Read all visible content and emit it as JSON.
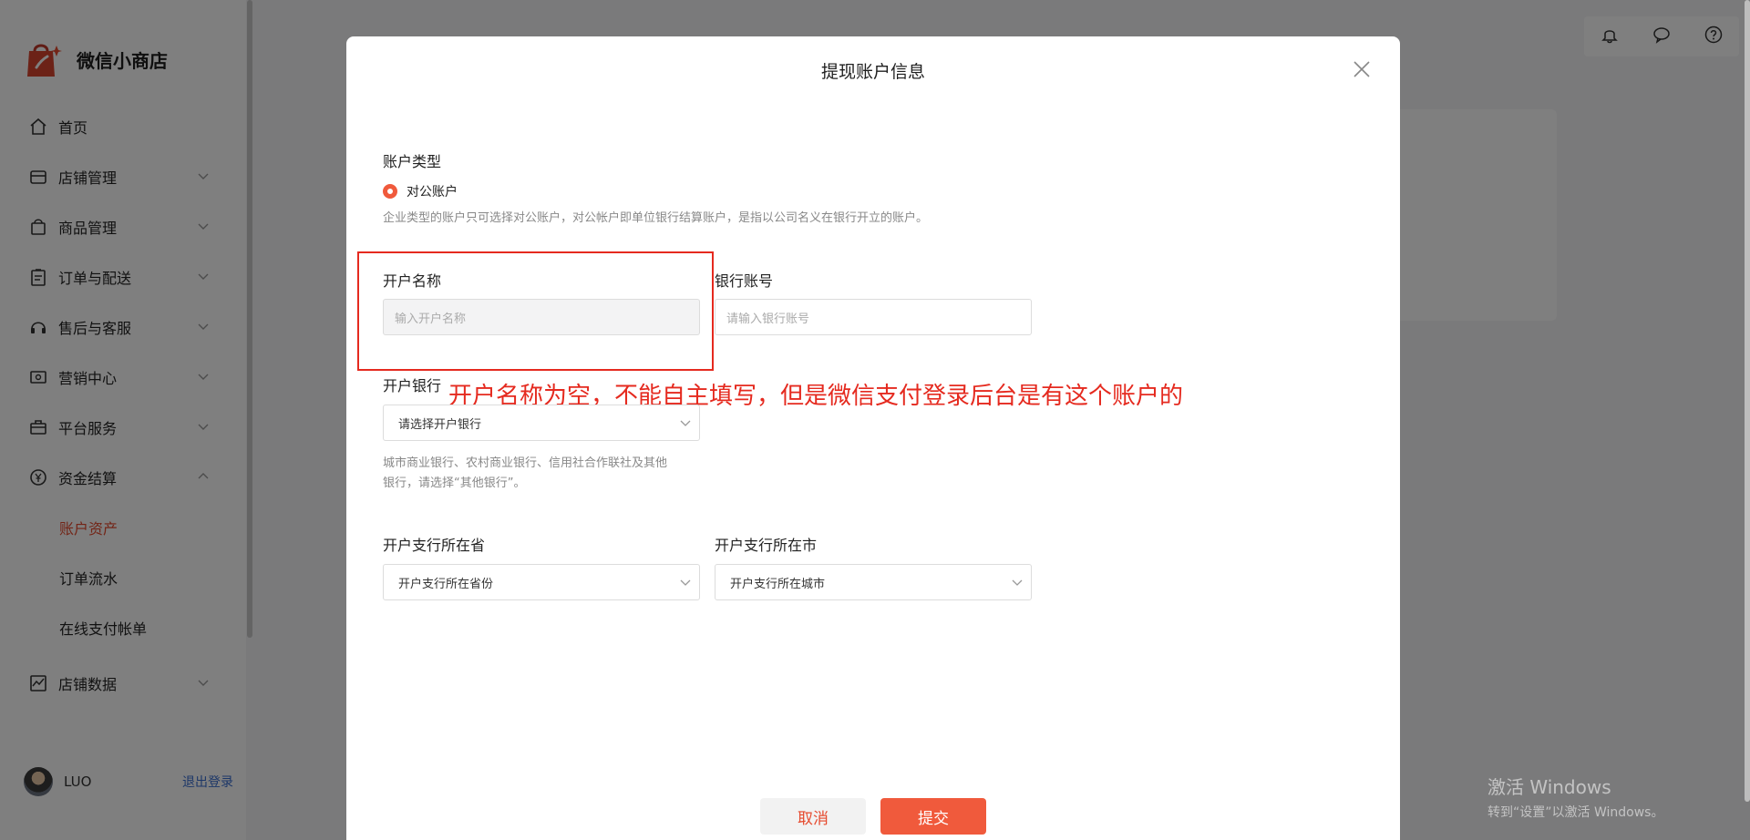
{
  "app": {
    "name": "微信小商店"
  },
  "sidebar": {
    "items": [
      {
        "label": "首页",
        "icon": "home-icon"
      },
      {
        "label": "店铺管理",
        "icon": "store-icon"
      },
      {
        "label": "商品管理",
        "icon": "bag-icon"
      },
      {
        "label": "订单与配送",
        "icon": "clipboard-icon"
      },
      {
        "label": "售后与客服",
        "icon": "headset-icon"
      },
      {
        "label": "营销中心",
        "icon": "ticket-icon"
      },
      {
        "label": "平台服务",
        "icon": "briefcase-icon"
      },
      {
        "label": "资金结算",
        "icon": "yen-icon"
      }
    ],
    "subitems": [
      {
        "label": "账户资产",
        "active": true
      },
      {
        "label": "订单流水",
        "active": false
      },
      {
        "label": "在线支付帐单",
        "active": false
      }
    ],
    "last_item": {
      "label": "店铺数据",
      "icon": "chart-icon"
    },
    "user": {
      "name": "LUO",
      "logout": "退出登录"
    }
  },
  "modal": {
    "title": "提现账户信息",
    "account_type_label": "账户类型",
    "account_type_option": "对公账户",
    "account_type_hint": "企业类型的账户只可选择对公账户，对公帐户即单位银行结算账户，是指以公司名义在银行开立的账户。",
    "account_name_label": "开户名称",
    "account_name_placeholder": "输入开户名称",
    "bank_account_label": "银行账号",
    "bank_account_placeholder": "请输入银行账号",
    "bank_label": "开户银行",
    "bank_select": "请选择开户银行",
    "bank_hint_1": "城市商业银行、农村商业银行、信用社合作联社及其他",
    "bank_hint_2": "银行，请选择“其他银行”。",
    "province_label": "开户支行所在省",
    "province_select": "开户支行所在省份",
    "city_label": "开户支行所在市",
    "city_select": "开户支行所在城市",
    "cancel": "取消",
    "submit": "提交",
    "annotation": "开户名称为空，不能自主填写，但是微信支付登录后台是有这个账户的"
  },
  "watermark": {
    "line1": "激活 Windows",
    "line2": "转到“设置”以激活 Windows。"
  },
  "colors": {
    "accent": "#f05a3c",
    "annotation": "#e52a1f"
  }
}
